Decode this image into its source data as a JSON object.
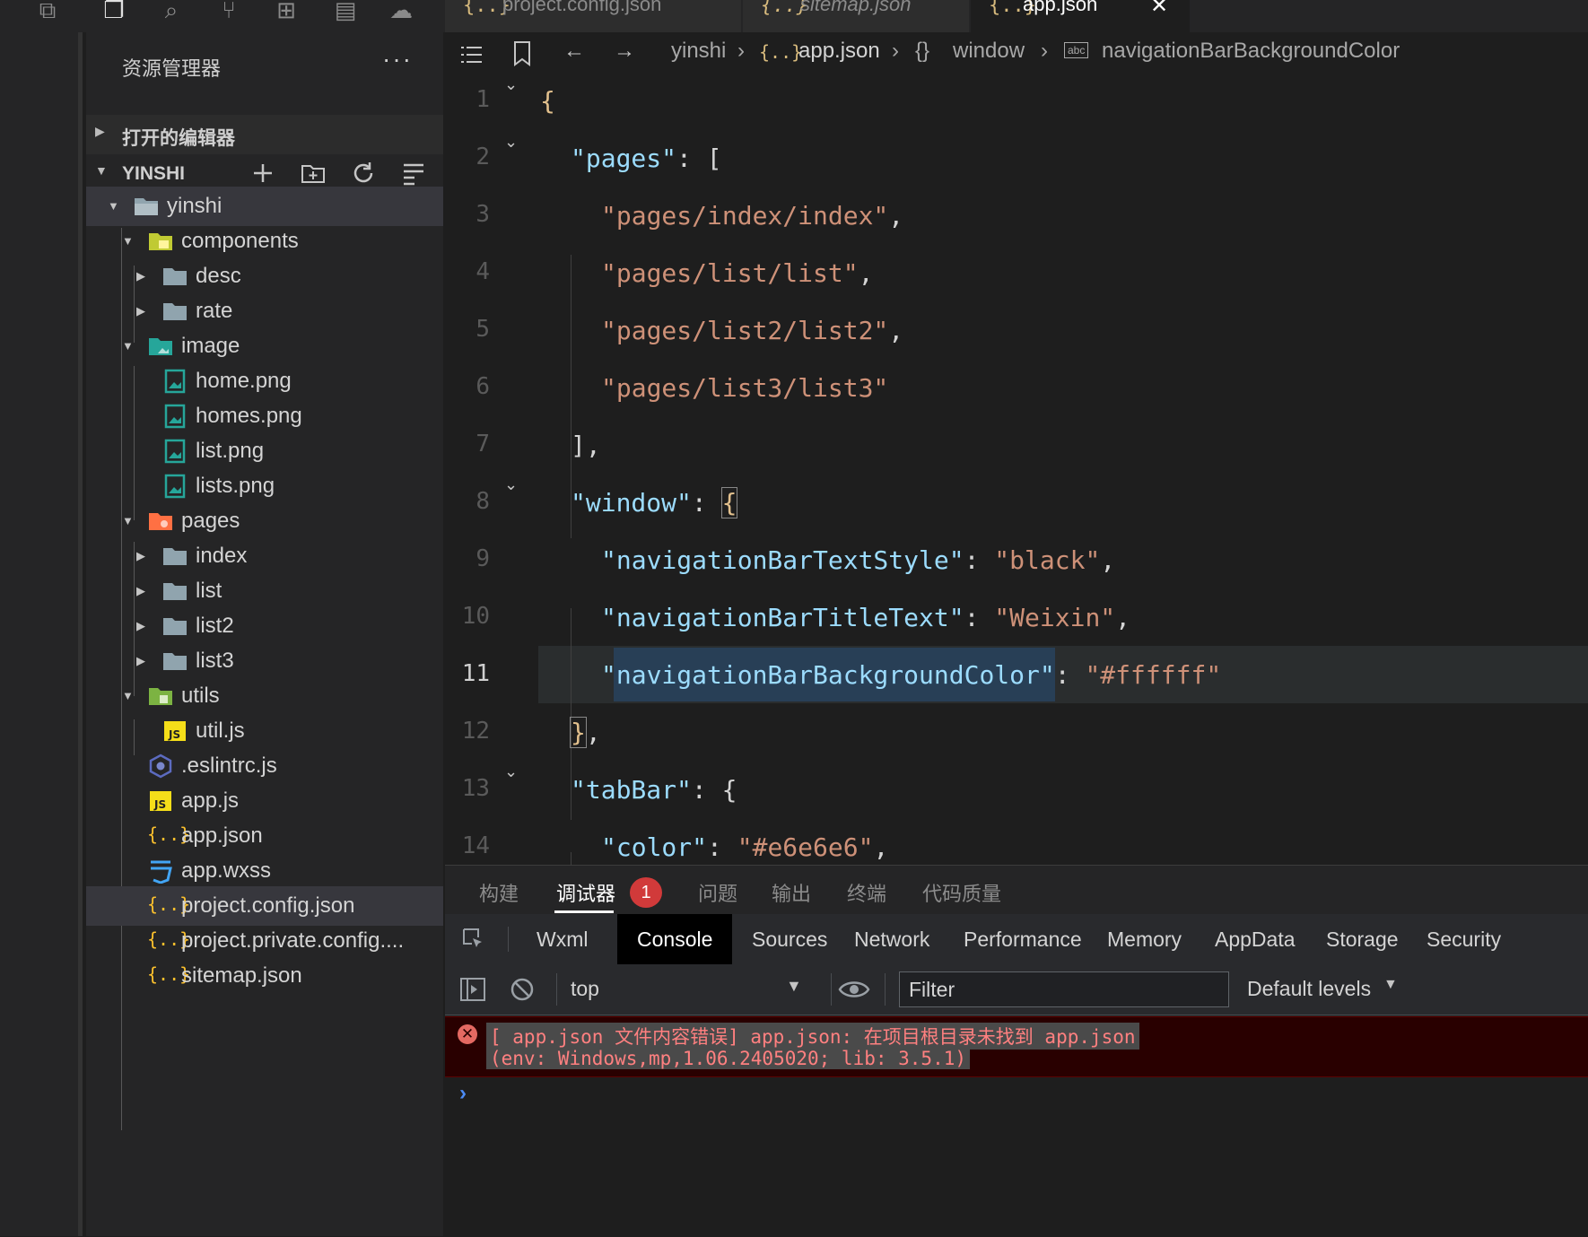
{
  "explorer": {
    "title": "资源管理器",
    "more": "···",
    "open_editors": "打开的编辑器",
    "workspace": "YINSHI",
    "tree": [
      {
        "label": "yinshi",
        "kind": "folder-open"
      },
      {
        "label": "components",
        "kind": "folder-components"
      },
      {
        "label": "desc",
        "kind": "folder"
      },
      {
        "label": "rate",
        "kind": "folder"
      },
      {
        "label": "image",
        "kind": "folder-image"
      },
      {
        "label": "home.png",
        "kind": "image"
      },
      {
        "label": "homes.png",
        "kind": "image"
      },
      {
        "label": "list.png",
        "kind": "image"
      },
      {
        "label": "lists.png",
        "kind": "image"
      },
      {
        "label": "pages",
        "kind": "folder-pages"
      },
      {
        "label": "index",
        "kind": "folder"
      },
      {
        "label": "list",
        "kind": "folder"
      },
      {
        "label": "list2",
        "kind": "folder"
      },
      {
        "label": "list3",
        "kind": "folder"
      },
      {
        "label": "utils",
        "kind": "folder-utils"
      },
      {
        "label": "util.js",
        "kind": "js"
      },
      {
        "label": ".eslintrc.js",
        "kind": "eslint"
      },
      {
        "label": "app.js",
        "kind": "js"
      },
      {
        "label": "app.json",
        "kind": "json"
      },
      {
        "label": "app.wxss",
        "kind": "css"
      },
      {
        "label": "project.config.json",
        "kind": "json"
      },
      {
        "label": "project.private.config....",
        "kind": "json"
      },
      {
        "label": "sitemap.json",
        "kind": "json"
      }
    ]
  },
  "tabs": [
    {
      "label": "project.config.json",
      "icon": "{..}"
    },
    {
      "label": "sitemap.json",
      "icon": "{..}"
    },
    {
      "label": "app.json",
      "icon": "{..}",
      "close": "✕"
    }
  ],
  "breadcrumb": {
    "folder": "yinshi",
    "file": "app.json",
    "object": "window",
    "property": "navigationBarBackgroundColor",
    "json_icon": "{..}",
    "obj_icon": "{}",
    "prop_icon": "abc"
  },
  "editor": {
    "line_numbers": [
      "1",
      "2",
      "3",
      "4",
      "5",
      "6",
      "7",
      "8",
      "9",
      "10",
      "11",
      "12",
      "13",
      "14"
    ],
    "current_line": "11",
    "code": {
      "l1": "{",
      "l2k": "\"pages\"",
      "l2p": ": [",
      "l3s": "\"pages/index/index\"",
      "l3p": ",",
      "l4s": "\"pages/list/list\"",
      "l4p": ",",
      "l5s": "\"pages/list2/list2\"",
      "l5p": ",",
      "l6s": "\"pages/list3/list3\"",
      "l7": "],",
      "l8k": "\"window\"",
      "l8p": ": ",
      "l8b": "{",
      "l9k": "\"navigationBarTextStyle\"",
      "l9p": ": ",
      "l9s": "\"black\"",
      "l9e": ",",
      "l10k": "\"navigationBarTitleText\"",
      "l10p": ": ",
      "l10s": "\"Weixin\"",
      "l10e": ",",
      "l11q": "\"",
      "l11k": "navigationBarBackgroundColor",
      "l11q2": "\"",
      "l11p": ": ",
      "l11s": "\"#ffffff\"",
      "l12b": "}",
      "l12p": ",",
      "l13k": "\"tabBar\"",
      "l13p": ": {",
      "l14k": "\"color\"",
      "l14p": ": ",
      "l14s": "\"#e6e6e6\"",
      "l14e": ","
    }
  },
  "panel": {
    "tabs": [
      "构建",
      "调试器",
      "问题",
      "输出",
      "终端",
      "代码质量"
    ],
    "badge": "1",
    "devtools_tabs": [
      "Wxml",
      "Console",
      "Sources",
      "Network",
      "Performance",
      "Memory",
      "AppData",
      "Storage",
      "Security"
    ],
    "context": "top",
    "filter_placeholder": "Filter",
    "levels": "Default levels",
    "error_line1": "[ app.json 文件内容错误] app.json: 在项目根目录未找到 app.json",
    "error_line2": "(env: Windows,mp,1.06.2405020; lib: 3.5.1)",
    "prompt": "›"
  },
  "colors": {
    "key": "#9cdcfe",
    "string": "#ce9178",
    "error_bg": "#290000",
    "badge": "#d13a3a"
  }
}
